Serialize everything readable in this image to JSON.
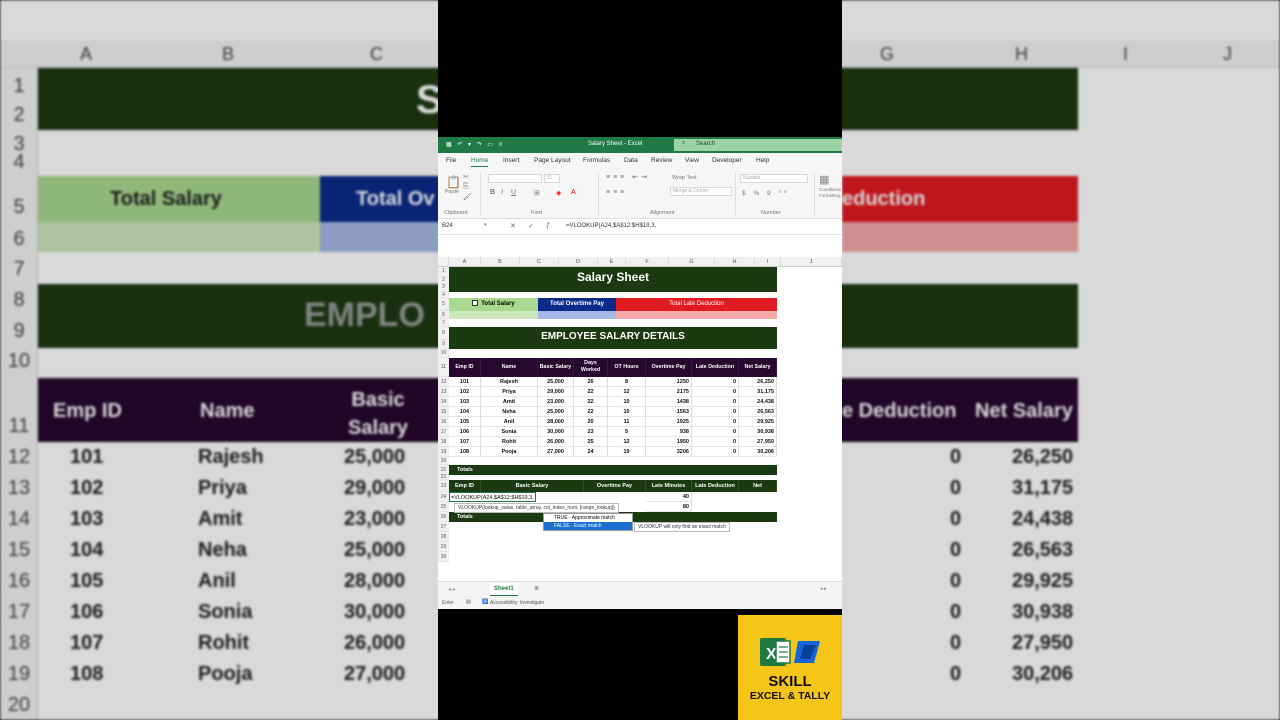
{
  "window": {
    "title": "Salary Sheet - Excel",
    "search": "Search"
  },
  "menu": [
    "File",
    "Home",
    "Insert",
    "Page Layout",
    "Formulas",
    "Data",
    "Review",
    "View",
    "Developer",
    "Help"
  ],
  "ribbon": {
    "groups": [
      "Clipboard",
      "Font",
      "Alignment",
      "Number"
    ],
    "paste": "Paste",
    "wrap_text": "Wrap Text",
    "merge_center": "Merge & Center",
    "number_format": "Number",
    "font_size": "11",
    "conditional": "Conditional Formatting"
  },
  "formula_bar": {
    "name_box": "B24",
    "formula": "=VLOOKUP(A24,$A$12:$H$19,3,"
  },
  "columns": [
    "A",
    "B",
    "C",
    "D",
    "E",
    "F",
    "G",
    "H",
    "I",
    "J"
  ],
  "rows": [
    "1",
    "2",
    "3",
    "4",
    "5",
    "6",
    "7",
    "8",
    "9",
    "10",
    "11",
    "12",
    "13",
    "14",
    "15",
    "16",
    "17",
    "18",
    "19",
    "20",
    "21",
    "22",
    "23",
    "24",
    "25",
    "26",
    "27",
    "28",
    "29",
    "30"
  ],
  "sheet": {
    "title": "Salary Sheet",
    "summary": [
      "Total Salary",
      "Total Overtime Pay",
      "Total Late Deduction"
    ],
    "section_title": "EMPLOYEE  SALARY DETAILS",
    "headers": [
      "Emp ID",
      "Name",
      "Basic Salary",
      "Days Worked",
      "OT Hours",
      "Overtime Pay",
      "Late Deduction",
      "Net Salary"
    ],
    "rows": [
      [
        "101",
        "Rajesh",
        "25,000",
        "26",
        "8",
        "1250",
        "0",
        "26,250"
      ],
      [
        "102",
        "Priya",
        "29,000",
        "22",
        "12",
        "2175",
        "0",
        "31,175"
      ],
      [
        "103",
        "Amit",
        "23,000",
        "22",
        "10",
        "1438",
        "0",
        "24,438"
      ],
      [
        "104",
        "Neha",
        "25,000",
        "22",
        "10",
        "1563",
        "0",
        "26,563"
      ],
      [
        "105",
        "Anil",
        "28,000",
        "20",
        "11",
        "1925",
        "0",
        "29,925"
      ],
      [
        "106",
        "Sonia",
        "30,000",
        "23",
        "5",
        "938",
        "0",
        "30,938"
      ],
      [
        "107",
        "Rohit",
        "26,000",
        "25",
        "12",
        "1950",
        "0",
        "27,950"
      ],
      [
        "108",
        "Pooja",
        "27,000",
        "24",
        "19",
        "3206",
        "0",
        "30,206"
      ]
    ],
    "totals": "Totals",
    "lookup_headers": [
      "Emp ID",
      "Basic Salary",
      "Overtime Pay",
      "Late Minutes",
      "Late Deduction",
      "Net"
    ],
    "lookup_edit": "=VLOOKUP(A24,$A$12:$H$19,3,",
    "lookup_minutes": [
      "40",
      "80"
    ],
    "lookup_totals": "Totals"
  },
  "autocomplete": {
    "hint": "VLOOKUP(lookup_value, table_array, col_index_num, [range_lookup])",
    "options": [
      "TRUE - Approximate match",
      "FALSE - Exact match"
    ],
    "desc": "VLOOKUP will only find an exact match"
  },
  "sheet_tab": "Sheet1",
  "status": {
    "mode": "Enter",
    "accessibility": "Accessibility: Investigate"
  },
  "badge": {
    "line1": "SKILL",
    "line2": "EXCEL & TALLY"
  },
  "background": {
    "columns": [
      "A",
      "B",
      "C",
      "G",
      "H",
      "I",
      "J"
    ],
    "rows": [
      "1",
      "2",
      "3",
      "4",
      "5",
      "6",
      "7",
      "8",
      "9",
      "10",
      "11",
      "12",
      "13",
      "14",
      "15",
      "16",
      "17",
      "18",
      "19",
      "20"
    ],
    "left_title": "S",
    "total_salary": "Total Salary",
    "total_ov": "Total Ov",
    "deduction": "eduction",
    "employee": "EMPLO",
    "hdr_empid": "Emp ID",
    "hdr_name": "Name",
    "hdr_basic": "Basic Salary",
    "hdr_deduction": "e Deduction",
    "hdr_net": "Net Salary"
  },
  "colors": {
    "excel_green": "#1f7a45",
    "dark_green": "#1c3a12",
    "purple": "#27082f",
    "red": "#e11b22",
    "navy": "#0b2a8a",
    "light_green": "#a9d88f",
    "badge_yellow": "#f5c518"
  }
}
